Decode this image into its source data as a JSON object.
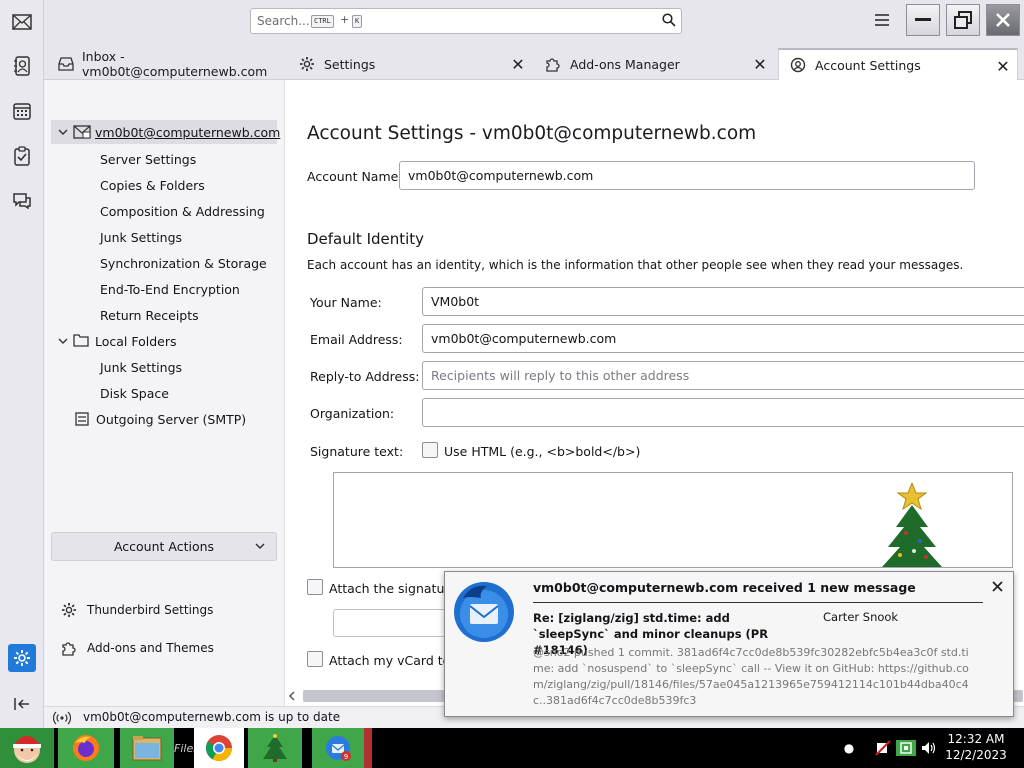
{
  "spaces": {
    "items": [
      "mail-icon",
      "address-book-icon",
      "calendar-icon",
      "tasks-icon",
      "chat-icon"
    ],
    "settings_icon": "gear-icon",
    "collapse_icon": "collapse-icon"
  },
  "titlebar": {
    "search_placeholder": "Search...",
    "shortcut_key1": "CTRL",
    "shortcut_plus": "+",
    "shortcut_key2": "K"
  },
  "tabs": [
    {
      "label": "Inbox - vm0b0t@computernewb.com",
      "icon": "inbox-icon"
    },
    {
      "label": "Settings",
      "icon": "gear-icon"
    },
    {
      "label": "Add-ons Manager",
      "icon": "puzzle-icon"
    },
    {
      "label": "Account Settings",
      "icon": "account-settings-icon",
      "active": true
    }
  ],
  "sidebar": {
    "account": "vm0b0t@computernewb.com",
    "items": [
      "Server Settings",
      "Copies & Folders",
      "Composition & Addressing",
      "Junk Settings",
      "Synchronization & Storage",
      "End-To-End Encryption",
      "Return Receipts"
    ],
    "local_folders": "Local Folders",
    "local_items": [
      "Junk Settings",
      "Disk Space"
    ],
    "outgoing": "Outgoing Server (SMTP)",
    "account_actions": "Account Actions",
    "thunderbird_settings": "Thunderbird Settings",
    "addons_themes": "Add-ons and Themes"
  },
  "main": {
    "title": "Account Settings - vm0b0t@computernewb.com",
    "account_name_label": "Account Name:",
    "account_name_value": "vm0b0t@computernewb.com",
    "identity_heading": "Default Identity",
    "identity_desc": "Each account has an identity, which is the information that other people see when they read your messages.",
    "your_name_label": "Your Name:",
    "your_name_value": "VM0b0t",
    "email_label": "Email Address:",
    "email_value": "vm0b0t@computernewb.com",
    "reply_to_label": "Reply-to Address:",
    "reply_to_placeholder": "Recipients will reply to this other address",
    "organization_label": "Organization:",
    "organization_value": "",
    "signature_label": "Signature text:",
    "use_html_label": "Use HTML (e.g., <b>bold</b>)",
    "use_html_checked": false,
    "attach_signature_label": "Attach the signature",
    "attach_signature_checked": false,
    "attach_vcard_label": "Attach my vCard to",
    "attach_vcard_checked": false
  },
  "status": {
    "text": "vm0b0t@computernewb.com is up to date"
  },
  "notification": {
    "title": "vm0b0t@computernewb.com received 1 new message",
    "subject": "Re: [ziglang/zig] std.time: add `sleepSync` and minor cleanups (PR #18146)",
    "sender": "Carter Snook",
    "body": "@sno2 pushed 1 commit. 381ad6f4c7cc0de8b539fc30282ebfc5b4ea3c0f std.time: add `nosuspend` to `sleepSync` call -- View it on GitHub: https://github.com/ziglang/zig/pull/18146/files/57ae045a1213965e759412114c101b44dba40c4c..381ad6f4c7cc0de8b539fc3"
  },
  "taskbar": {
    "files_label": "Files",
    "badge": "9",
    "time": "12:32 AM",
    "date": "12/2/2023"
  },
  "colors": {
    "accent": "#1f7ad9",
    "taskbar_green": "#3fa64a"
  }
}
